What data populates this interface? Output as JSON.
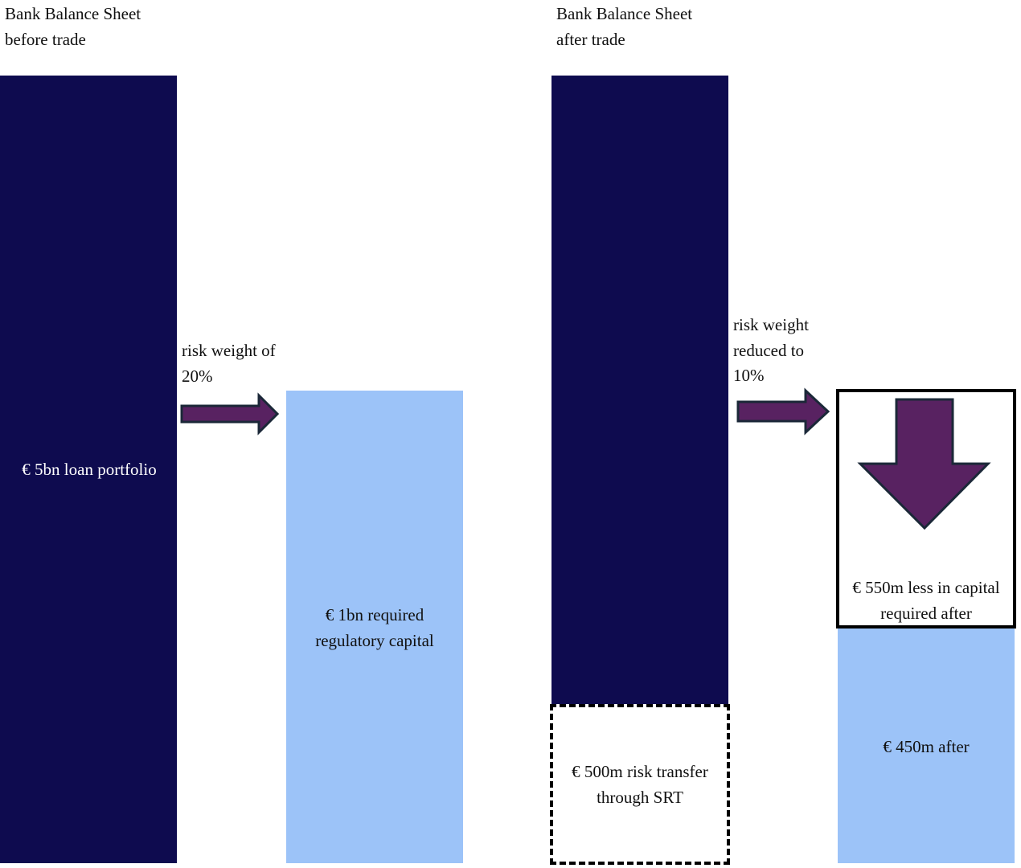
{
  "before": {
    "heading": [
      "Bank Balance Sheet",
      "before trade"
    ],
    "loan_label": "€ 5bn loan portfolio",
    "risk_note": [
      "risk weight of",
      "20%"
    ],
    "capital_label": [
      "€ 1bn required",
      "regulatory capital"
    ]
  },
  "after": {
    "heading": [
      "Bank Balance Sheet",
      "after trade"
    ],
    "srt_label": [
      "€ 500m risk transfer",
      "through SRT"
    ],
    "risk_note": [
      "risk weight",
      "reduced to",
      "10%"
    ],
    "savings_label": [
      "€ 550m less in capital",
      "required after"
    ],
    "capital_label": "€ 450m after"
  },
  "colors": {
    "loan_portfolio": "#0e0b4f",
    "capital": "#9cc3f8",
    "arrow_fill": "#582261",
    "arrow_outline": "#1b2838"
  }
}
